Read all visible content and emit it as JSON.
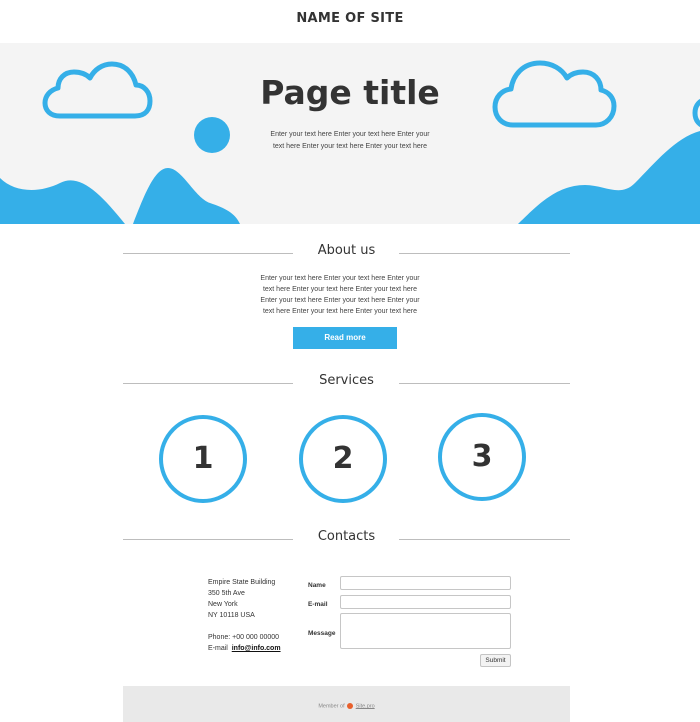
{
  "site": {
    "name": "NAME OF SITE"
  },
  "hero": {
    "title": "Page title",
    "text": "Enter your text here Enter your text here Enter your text here Enter your text here Enter your text here"
  },
  "about": {
    "title": "About us",
    "text": "Enter your text here Enter your text here Enter your text here Enter your text here Enter your text here Enter your text here Enter your text here Enter your text here Enter your text here Enter your text here",
    "button_label": "Read more"
  },
  "services": {
    "title": "Services",
    "items": [
      "1",
      "2",
      "3"
    ]
  },
  "contacts": {
    "title": "Contacts",
    "address_lines": [
      "Empire State Building",
      "350 5th Ave",
      "New York",
      "NY 10118 USA"
    ],
    "phone": "Phone: +00 000 00000",
    "email_label": "E-mail",
    "email": "info@info.com",
    "form": {
      "name_label": "Name",
      "email_label": "E-mail",
      "message_label": "Message",
      "name_value": "",
      "email_value": "",
      "message_value": "",
      "submit_label": "Submit"
    }
  },
  "footer": {
    "prefix": "Member of",
    "link": "Site.pro"
  },
  "colors": {
    "accent": "#35afe8",
    "hero_bg": "#f4f4f4",
    "footer_bg": "#e9e9e9"
  },
  "icons": [
    "cloud-icon",
    "sun-icon",
    "mountain-icon",
    "site-pro-logo-icon"
  ]
}
